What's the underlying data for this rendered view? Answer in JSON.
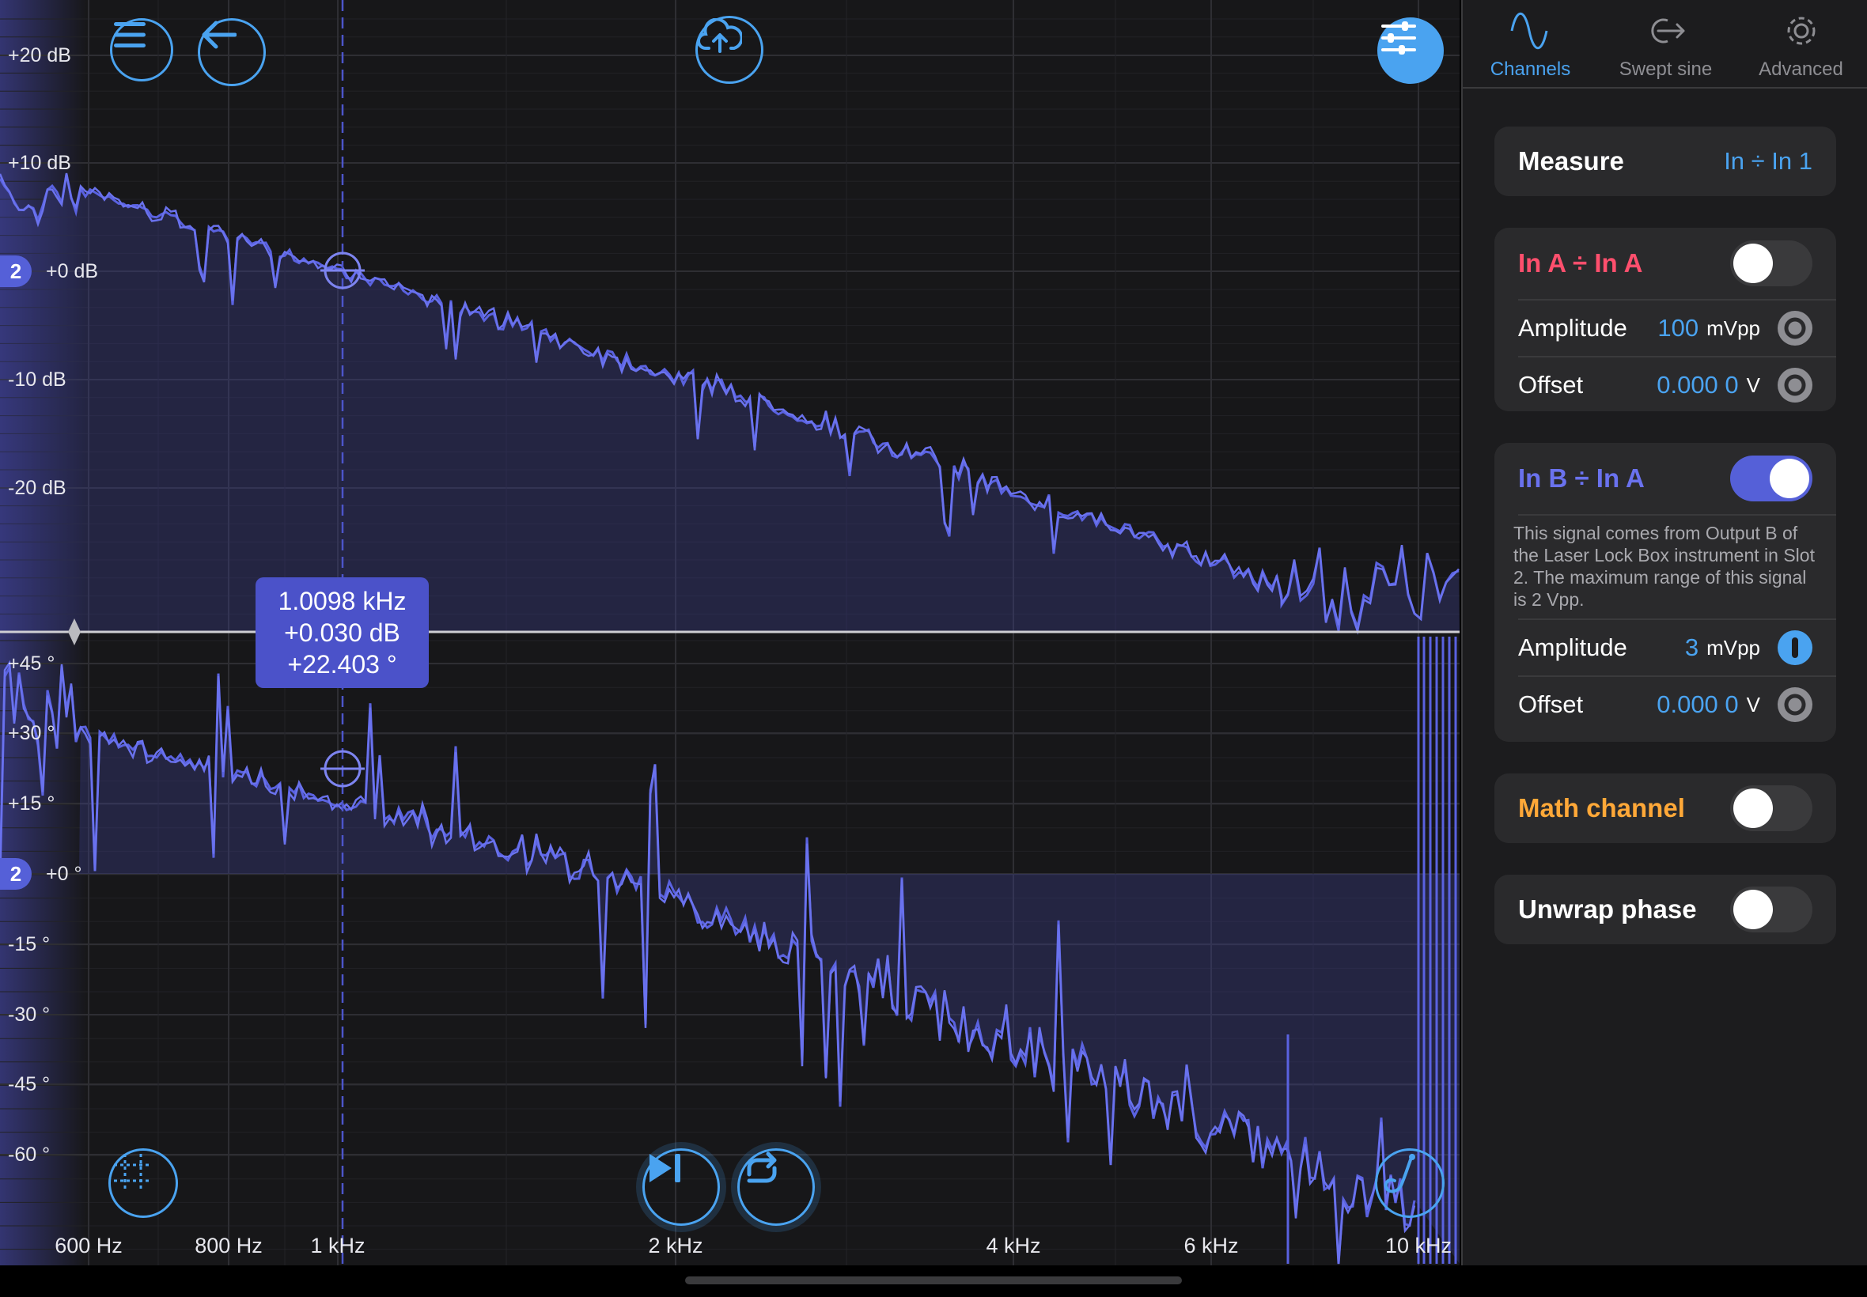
{
  "plot": {
    "magnitude_labels": [
      "+20 dB",
      "+10 dB",
      "+0 dB",
      "-10 dB",
      "-20 dB"
    ],
    "phase_labels": [
      "+45 °",
      "+30 °",
      "+15 °",
      "+0 °",
      "-15 °",
      "-30 °",
      "-45 °",
      "-60 °"
    ],
    "freq_labels": [
      "600 Hz",
      "800 Hz",
      "1 kHz",
      "2 kHz",
      "4 kHz",
      "6 kHz",
      "10 kHz"
    ],
    "channel_marker": "2",
    "cursor": {
      "freq": "1.0098 kHz",
      "mag": "+0.030 dB",
      "phase": "+22.403 °"
    }
  },
  "toolbar": {
    "menu_icon": "hamburger-menu-icon",
    "back_icon": "back-arrow-icon",
    "upload_icon": "cloud-upload-icon",
    "settings_icon": "sliders-icon",
    "grid_icon": "grid-crosshair-icon",
    "play_icon": "play-step-icon",
    "loop_icon": "loop-icon",
    "probe_icon": "probe-icon"
  },
  "tabs": [
    {
      "label": "Channels",
      "icon": "sine-wave-icon",
      "active": true
    },
    {
      "label": "Swept sine",
      "icon": "sweep-arrow-icon",
      "active": false
    },
    {
      "label": "Advanced",
      "icon": "gear-icon",
      "active": false
    }
  ],
  "measure": {
    "label": "Measure",
    "value": "In ÷ In 1"
  },
  "in_a": {
    "title": "In A ÷ In A",
    "title_color": "#ff4f6d",
    "enabled": false,
    "amplitude_label": "Amplitude",
    "amplitude_value": "100",
    "amplitude_unit": "mVpp",
    "offset_label": "Offset",
    "offset_value": "0.000 0",
    "offset_unit": "V"
  },
  "in_b": {
    "title": "In B ÷ In A",
    "title_color": "#6a72ee",
    "enabled": true,
    "description": "This signal comes from Output B of the Laser Lock Box instrument in Slot 2. The maximum range of this signal is 2 Vpp.",
    "amplitude_label": "Amplitude",
    "amplitude_value": "3",
    "amplitude_unit": "mVpp",
    "offset_label": "Offset",
    "offset_value": "0.000 0",
    "offset_unit": "V"
  },
  "math_channel": {
    "label": "Math channel",
    "color": "#ffa838",
    "enabled": false
  },
  "unwrap_phase": {
    "label": "Unwrap phase",
    "enabled": false
  },
  "colors": {
    "accent": "#4aa3f0",
    "trace": "#5a62e0",
    "panel": "#1c1c1e"
  }
}
